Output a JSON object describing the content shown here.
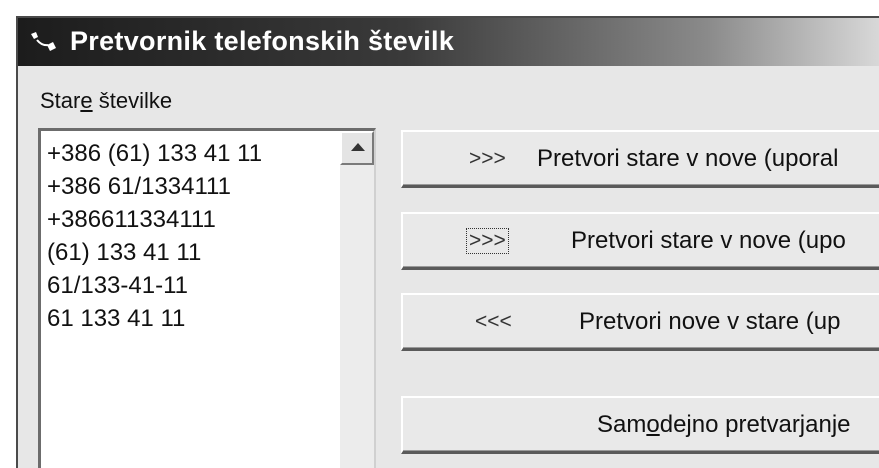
{
  "window": {
    "title": "Pretvornik telefonskih številk"
  },
  "list": {
    "label_before": "Star",
    "label_mnemonic": "e",
    "label_after": " številke",
    "items": [
      "+386 (61) 133 41 11",
      "+386 61/1334111",
      "+386611334111",
      "(61) 133 41 11",
      "61/133-41-11",
      "61 133 41 11"
    ]
  },
  "buttons": {
    "convert_old_to_new_1": {
      "arrows": ">>>",
      "label": "Pretvori stare v nove (uporal"
    },
    "convert_old_to_new_2": {
      "arrows": ">>>",
      "label": "Pretvori stare v nove (upo"
    },
    "convert_new_to_old": {
      "arrows": "<<<",
      "label": "Pretvori nove v stare (up"
    },
    "auto_convert": {
      "label_before": "Sam",
      "label_mnemonic": "o",
      "label_after": "dejno pretvarjanje"
    }
  }
}
